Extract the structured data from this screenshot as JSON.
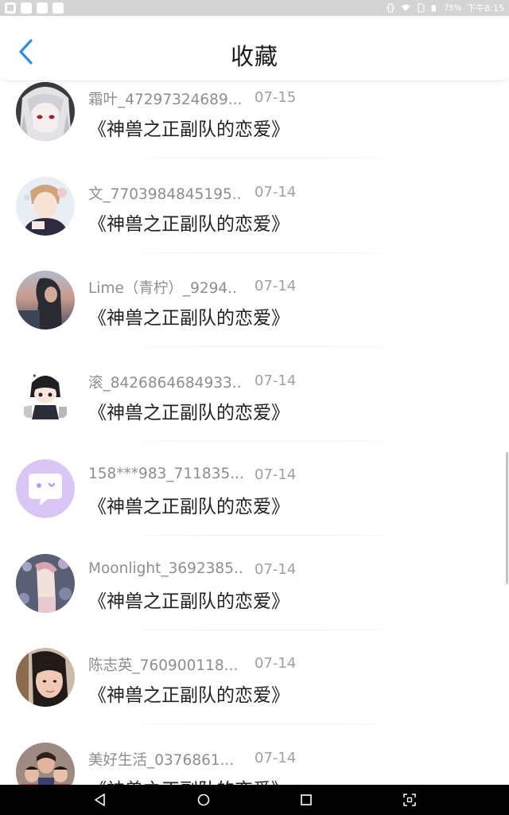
{
  "status_bar": {
    "battery": "75%",
    "time": "下午8:15"
  },
  "header": {
    "title": "收藏"
  },
  "items": [
    {
      "name": "霜叶_47297324689...",
      "date": "07-15",
      "title": "《神兽之正副队的恋爱》",
      "avatar": "anime-girl-silver-hair"
    },
    {
      "name": "文_7703984845195..",
      "date": "07-14",
      "title": "《神兽之正副队的恋爱》",
      "avatar": "anime-boy-illustration"
    },
    {
      "name": "Lime（青柠）_9294..",
      "date": "07-14",
      "title": "《神兽之正副队的恋爱》",
      "avatar": "sunset-girl-photo"
    },
    {
      "name": "滚_8426864684933..",
      "date": "07-14",
      "title": "《神兽之正副队的恋爱》",
      "avatar": "chibi-character"
    },
    {
      "name": "158***983_711835...",
      "date": "07-14",
      "title": "《神兽之正副队的恋爱》",
      "avatar": "chat-bubble-default"
    },
    {
      "name": "Moonlight_3692385..",
      "date": "07-14",
      "title": "《神兽之正副队的恋爱》",
      "avatar": "floral-girl-art"
    },
    {
      "name": "陈志英_760900118...",
      "date": "07-14",
      "title": "《神兽之正副队的恋爱》",
      "avatar": "selfie-girl-photo"
    },
    {
      "name": "美好生活_0376861...",
      "date": "07-14",
      "title": "《神兽之正副队的恋爱》",
      "avatar": "family-photo"
    }
  ],
  "colors": {
    "accent": "#2a8de8",
    "status_bar": "#d4d4d4",
    "nav_bar": "#000000",
    "default_avatar": "#d9c6f5"
  },
  "icons": {
    "back": "chevron-left-icon",
    "nav": [
      "back-triangle-icon",
      "home-circle-icon",
      "recents-square-icon",
      "screenshot-icon"
    ]
  }
}
